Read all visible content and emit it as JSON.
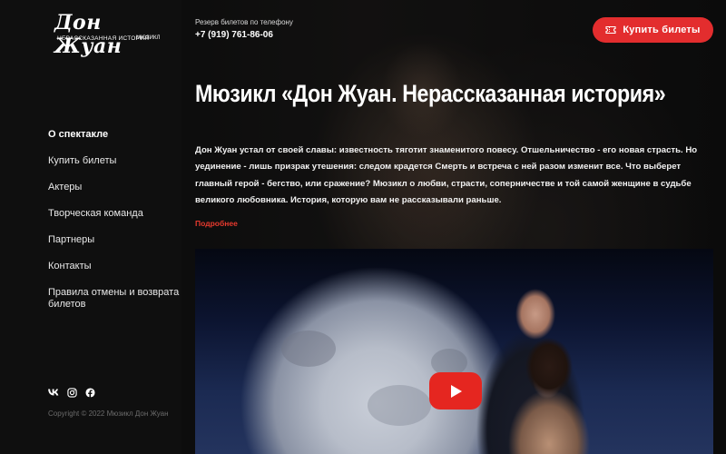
{
  "logo": {
    "title": "Дон Жуан",
    "subtitle": "НЕРАССКАЗАННАЯ ИСТОРИЯ",
    "tag": "МЮЗИКЛ"
  },
  "header": {
    "phone_caption": "Резерв билетов по телефону",
    "phone_number": "+7 (919) 761-86-06",
    "buy_label": "Купить билеты"
  },
  "sidebar": {
    "items": [
      {
        "label": "О спектакле",
        "active": true
      },
      {
        "label": "Купить билеты"
      },
      {
        "label": "Актеры"
      },
      {
        "label": "Творческая команда"
      },
      {
        "label": "Партнеры"
      },
      {
        "label": "Контакты"
      },
      {
        "label": "Правила отмены и возврата билетов"
      }
    ],
    "socials": [
      "vk-icon",
      "instagram-icon",
      "facebook-icon"
    ],
    "copyright": "Copyright © 2022 Мюзикл Дон Жуан"
  },
  "main": {
    "title": "Мюзикл «Дон Жуан. Нерассказанная история»",
    "description": "Дон Жуан устал от своей славы: известность тяготит знаменитого повесу. Отшельничество - его новая страсть. Но уединение - лишь призрак утешения: следом крадется Смерть и встреча с ней разом изменит все. Что выберет главный герой - бегство, или сражение? Мюзикл о любви, страсти, соперничестве и той самой женщине в судьбе великого любовника. История, которую вам не рассказывали раньше.",
    "more_label": "Подробнее"
  },
  "colors": {
    "accent": "#e32d2e",
    "link": "#e83a2e",
    "play": "#e52620",
    "background": "#121212"
  }
}
